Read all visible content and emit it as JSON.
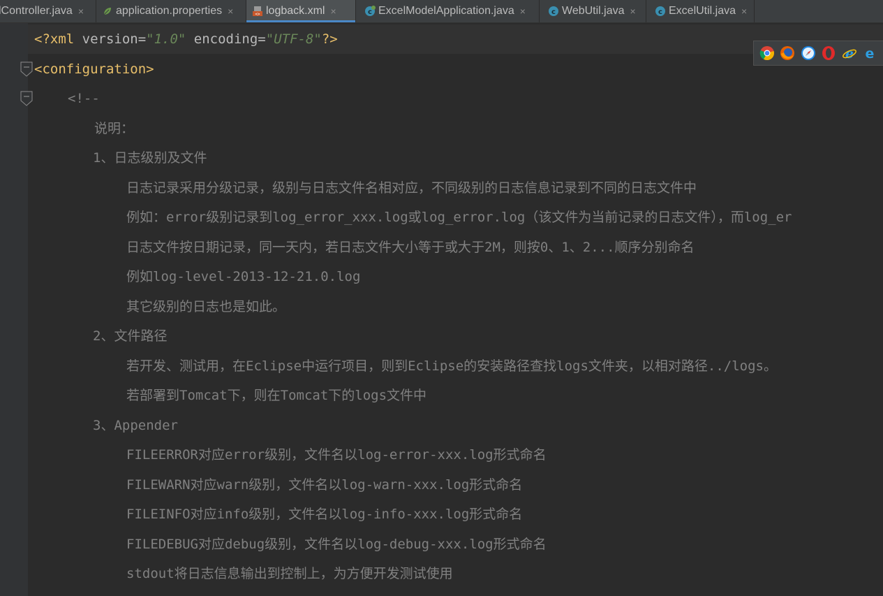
{
  "tabs": [
    {
      "label": "lController.java",
      "icon": "java-class-icon",
      "active": false
    },
    {
      "label": "application.properties",
      "icon": "spring-leaf-icon",
      "active": false
    },
    {
      "label": "logback.xml",
      "icon": "xml-file-icon",
      "active": true
    },
    {
      "label": "ExcelModelApplication.java",
      "icon": "spring-class-icon",
      "active": false
    },
    {
      "label": "WebUtil.java",
      "icon": "java-class-icon",
      "active": false
    },
    {
      "label": "ExcelUtil.java",
      "icon": "java-class-icon",
      "active": false
    }
  ],
  "close_glyph": "×",
  "editor": {
    "xml_decl": {
      "open": "<?xml ",
      "attr1": "version=",
      "val1": "\"1.0\"",
      "attr2": " encoding=",
      "val2": "\"UTF-8\"",
      "close": "?>"
    },
    "config_tag": "<configuration>",
    "comment_open": "<!--",
    "comment_lines": [
      "说明：",
      "1、日志级别及文件",
      "日志记录采用分级记录，级别与日志文件名相对应，不同级别的日志信息记录到不同的日志文件中",
      "例如：error级别记录到log_error_xxx.log或log_error.log（该文件为当前记录的日志文件），而log_er",
      "日志文件按日期记录，同一天内，若日志文件大小等于或大于2M，则按0、1、2...顺序分别命名",
      "例如log-level-2013-12-21.0.log",
      "其它级别的日志也是如此。",
      "2、文件路径",
      "若开发、测试用，在Eclipse中运行项目，则到Eclipse的安装路径查找logs文件夹，以相对路径../logs。",
      "若部署到Tomcat下，则在Tomcat下的logs文件中",
      "3、Appender",
      "FILEERROR对应error级别，文件名以log-error-xxx.log形式命名",
      "FILEWARN对应warn级别，文件名以log-warn-xxx.log形式命名",
      "FILEINFO对应info级别，文件名以log-info-xxx.log形式命名",
      "FILEDEBUG对应debug级别，文件名以log-debug-xxx.log形式命名",
      "stdout将日志信息输出到控制上，为方便开发测试使用"
    ]
  },
  "browsers": [
    "chrome-icon",
    "firefox-icon",
    "safari-icon",
    "opera-icon",
    "ie-icon",
    "edge-icon"
  ],
  "colors": {
    "background": "#2b2b2b",
    "tag": "#e8bf6a",
    "string": "#6a8759",
    "comment": "#808080",
    "active_tab_underline": "#4a88c7"
  }
}
